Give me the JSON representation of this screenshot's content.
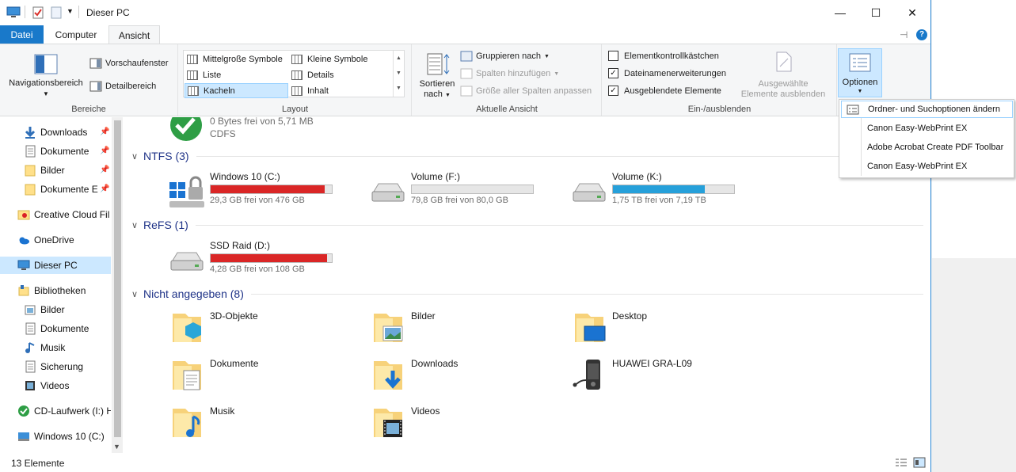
{
  "window": {
    "title": "Dieser PC",
    "minimize": "—",
    "maximize": "☐",
    "close": "✕"
  },
  "tabs": {
    "file": "Datei",
    "computer": "Computer",
    "view": "Ansicht"
  },
  "ribbon": {
    "bereiche": {
      "label": "Bereiche",
      "navigation": "Navigationsbereich",
      "preview": "Vorschaufenster",
      "details": "Detailbereich"
    },
    "layout": {
      "label": "Layout",
      "items": [
        "Mittelgroße Symbole",
        "Kleine Symbole",
        "Liste",
        "Details",
        "Kacheln",
        "Inhalt"
      ]
    },
    "current_view": {
      "label": "Aktuelle Ansicht",
      "sort": "Sortieren",
      "sort2": "nach",
      "group": "Gruppieren nach",
      "add_columns": "Spalten hinzufügen",
      "fit_columns": "Größe aller Spalten anpassen"
    },
    "show_hide": {
      "label": "Ein-/ausblenden",
      "item_checkboxes": "Elementkontrollkästchen",
      "extensions": "Dateinamenerweiterungen",
      "hidden_items": "Ausgeblendete Elemente",
      "hide_selected_1": "Ausgewählte",
      "hide_selected_2": "Elemente ausblenden"
    },
    "options": "Optionen"
  },
  "options_menu": [
    "Ordner- und Suchoptionen ändern",
    "Canon Easy-WebPrint EX",
    "Adobe Acrobat Create PDF Toolbar",
    "Canon Easy-WebPrint EX"
  ],
  "nav": {
    "downloads": "Downloads",
    "dokumente": "Dokumente",
    "bilder": "Bilder",
    "dokumente_e": "Dokumente E",
    "creative_cloud": "Creative Cloud Fil",
    "onedrive": "OneDrive",
    "dieser_pc": "Dieser PC",
    "bibliotheken": "Bibliotheken",
    "lib_bilder": "Bilder",
    "lib_dokumente": "Dokumente",
    "lib_musik": "Musik",
    "lib_sicherung": "Sicherung",
    "lib_videos": "Videos",
    "cd": "CD-Laufwerk (I:) H",
    "win10": "Windows 10 (C:)"
  },
  "content": {
    "cd_line1": "0 Bytes frei von 5,71 MB",
    "cd_line2": "CDFS",
    "sections": {
      "ntfs": "NTFS (3)",
      "refs": "ReFS (1)",
      "nicht": "Nicht angegeben (8)"
    },
    "drives": [
      {
        "name": "Windows 10 (C:)",
        "free": "29,3 GB frei von 476 GB",
        "used_fraction": 0.94,
        "color": "#da2626"
      },
      {
        "name": "Volume (F:)",
        "free": "79,8 GB frei von 80,0 GB",
        "used_fraction": 0.0,
        "color": "#26a0da"
      },
      {
        "name": "Volume (K:)",
        "free": "1,75 TB frei von 7,19 TB",
        "used_fraction": 0.76,
        "color": "#26a0da"
      },
      {
        "name": "SSD Raid (D:)",
        "free": "4,28 GB frei von 108 GB",
        "used_fraction": 0.96,
        "color": "#da2626"
      }
    ],
    "folders": [
      "3D-Objekte",
      "Bilder",
      "Desktop",
      "Dokumente",
      "Downloads",
      "HUAWEI GRA-L09",
      "Musik",
      "Videos"
    ]
  },
  "status": {
    "count": "13 Elemente"
  }
}
